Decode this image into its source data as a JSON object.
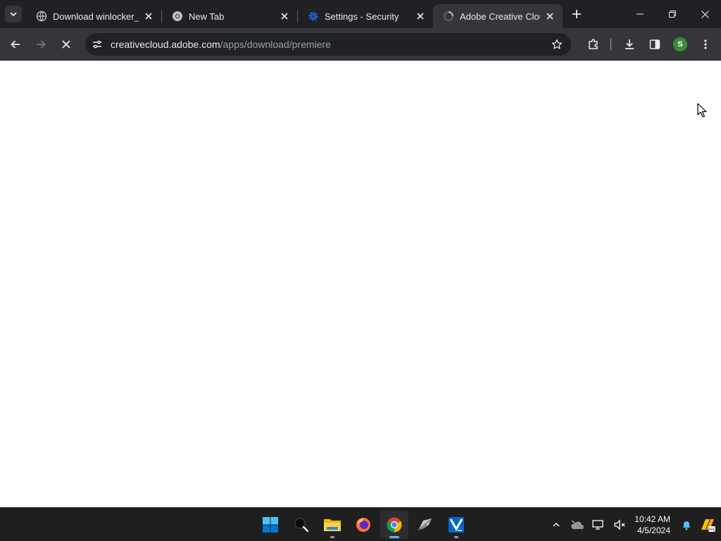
{
  "browser": {
    "tabs": [
      {
        "title": "Download winlocker_b",
        "favicon": "globe-icon",
        "active": false
      },
      {
        "title": "New Tab",
        "favicon": "chrome-icon",
        "active": false
      },
      {
        "title": "Settings - Security",
        "favicon": "gear-icon",
        "active": false
      },
      {
        "title": "Adobe Creative Cloud",
        "favicon": "globe-icon",
        "active": true
      }
    ],
    "address": {
      "domain": "creativecloud.adobe.com",
      "path": "/apps/download/premiere"
    },
    "profile_initial": "S",
    "colors": {
      "frame": "#202124",
      "toolbar": "#35363a",
      "accent": "#8ab4f8",
      "profile": "#3d8b37"
    }
  },
  "taskbar": {
    "apps": [
      {
        "name": "start",
        "icon": "windows-start-icon"
      },
      {
        "name": "search",
        "icon": "search-icon"
      },
      {
        "name": "file-explorer",
        "icon": "folder-icon"
      },
      {
        "name": "firefox",
        "icon": "firefox-icon"
      },
      {
        "name": "chrome",
        "icon": "chrome-icon",
        "active": true
      },
      {
        "name": "app-6",
        "icon": "feather-app-icon"
      },
      {
        "name": "app-7",
        "icon": "blue-app-icon"
      }
    ],
    "clock": {
      "time": "10:42 AM",
      "date": "4/5/2024"
    }
  }
}
